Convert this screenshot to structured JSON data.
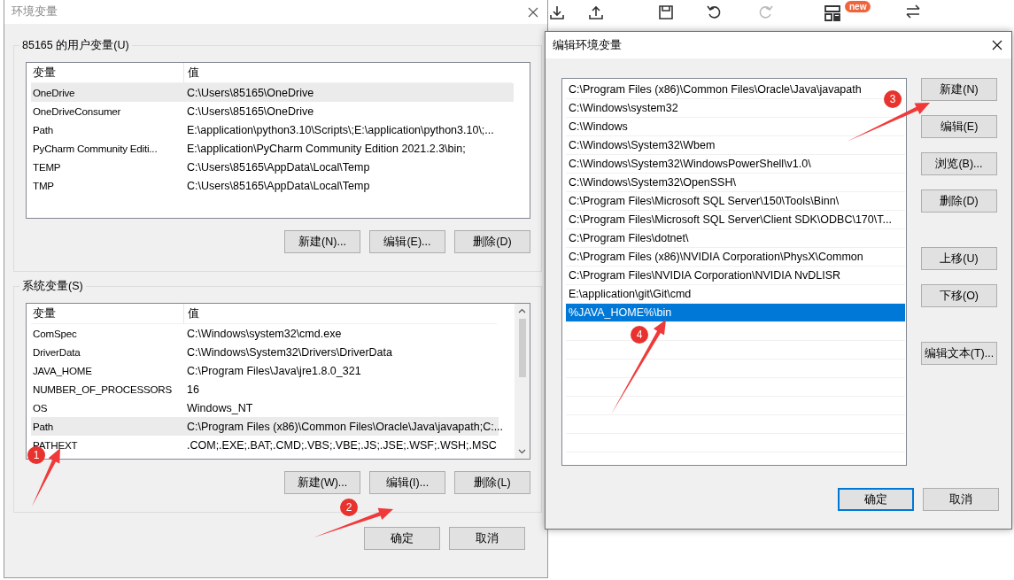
{
  "background_app": {
    "badge": "new"
  },
  "env_dialog": {
    "title": "环境变量",
    "user_group": {
      "legend": "85165 的用户变量(U)",
      "columns": [
        "变量",
        "值"
      ],
      "rows": [
        {
          "name": "OneDrive",
          "value": "C:\\Users\\85165\\OneDrive",
          "selected": true
        },
        {
          "name": "OneDriveConsumer",
          "value": "C:\\Users\\85165\\OneDrive",
          "selected": false
        },
        {
          "name": "Path",
          "value": "E:\\application\\python3.10\\Scripts\\;E:\\application\\python3.10\\;...",
          "selected": false
        },
        {
          "name": "PyCharm Community Editi...",
          "value": "E:\\application\\PyCharm Community Edition 2021.2.3\\bin;",
          "selected": false
        },
        {
          "name": "TEMP",
          "value": "C:\\Users\\85165\\AppData\\Local\\Temp",
          "selected": false
        },
        {
          "name": "TMP",
          "value": "C:\\Users\\85165\\AppData\\Local\\Temp",
          "selected": false
        }
      ],
      "buttons": [
        "新建(N)...",
        "编辑(E)...",
        "删除(D)"
      ]
    },
    "system_group": {
      "legend": "系统变量(S)",
      "columns": [
        "变量",
        "值"
      ],
      "rows": [
        {
          "name": "ComSpec",
          "value": "C:\\Windows\\system32\\cmd.exe",
          "selected": false
        },
        {
          "name": "DriverData",
          "value": "C:\\Windows\\System32\\Drivers\\DriverData",
          "selected": false
        },
        {
          "name": "JAVA_HOME",
          "value": "C:\\Program Files\\Java\\jre1.8.0_321",
          "selected": false
        },
        {
          "name": "NUMBER_OF_PROCESSORS",
          "value": "16",
          "selected": false
        },
        {
          "name": "OS",
          "value": "Windows_NT",
          "selected": false
        },
        {
          "name": "Path",
          "value": "C:\\Program Files (x86)\\Common Files\\Oracle\\Java\\javapath;C:...",
          "selected": true
        },
        {
          "name": "PATHEXT",
          "value": ".COM;.EXE;.BAT;.CMD;.VBS;.VBE;.JS;.JSE;.WSF;.WSH;.MSC",
          "selected": false
        }
      ],
      "buttons": [
        "新建(W)...",
        "编辑(I)...",
        "删除(L)"
      ]
    },
    "buttons": [
      "确定",
      "取消"
    ]
  },
  "edit_dialog": {
    "title": "编辑环境变量",
    "entries": [
      {
        "text": "C:\\Program Files (x86)\\Common Files\\Oracle\\Java\\javapath",
        "selected": false
      },
      {
        "text": "C:\\Windows\\system32",
        "selected": false
      },
      {
        "text": "C:\\Windows",
        "selected": false
      },
      {
        "text": "C:\\Windows\\System32\\Wbem",
        "selected": false
      },
      {
        "text": "C:\\Windows\\System32\\WindowsPowerShell\\v1.0\\",
        "selected": false
      },
      {
        "text": "C:\\Windows\\System32\\OpenSSH\\",
        "selected": false
      },
      {
        "text": "C:\\Program Files\\Microsoft SQL Server\\150\\Tools\\Binn\\",
        "selected": false
      },
      {
        "text": "C:\\Program Files\\Microsoft SQL Server\\Client SDK\\ODBC\\170\\T...",
        "selected": false
      },
      {
        "text": "C:\\Program Files\\dotnet\\",
        "selected": false
      },
      {
        "text": "C:\\Program Files (x86)\\NVIDIA Corporation\\PhysX\\Common",
        "selected": false
      },
      {
        "text": "C:\\Program Files\\NVIDIA Corporation\\NVIDIA NvDLISR",
        "selected": false
      },
      {
        "text": "E:\\application\\git\\Git\\cmd",
        "selected": false
      },
      {
        "text": "%JAVA_HOME%\\bin",
        "selected": true
      }
    ],
    "side_buttons": [
      [
        "新建(N)",
        "编辑(E)",
        "浏览(B)...",
        "删除(D)"
      ],
      [
        "上移(U)",
        "下移(O)"
      ],
      [
        "编辑文本(T)..."
      ]
    ],
    "buttons": [
      {
        "label": "确定",
        "default": true
      },
      {
        "label": "取消",
        "default": false
      }
    ]
  },
  "annotations": [
    {
      "label": "1"
    },
    {
      "label": "2"
    },
    {
      "label": "3"
    },
    {
      "label": "4"
    }
  ]
}
